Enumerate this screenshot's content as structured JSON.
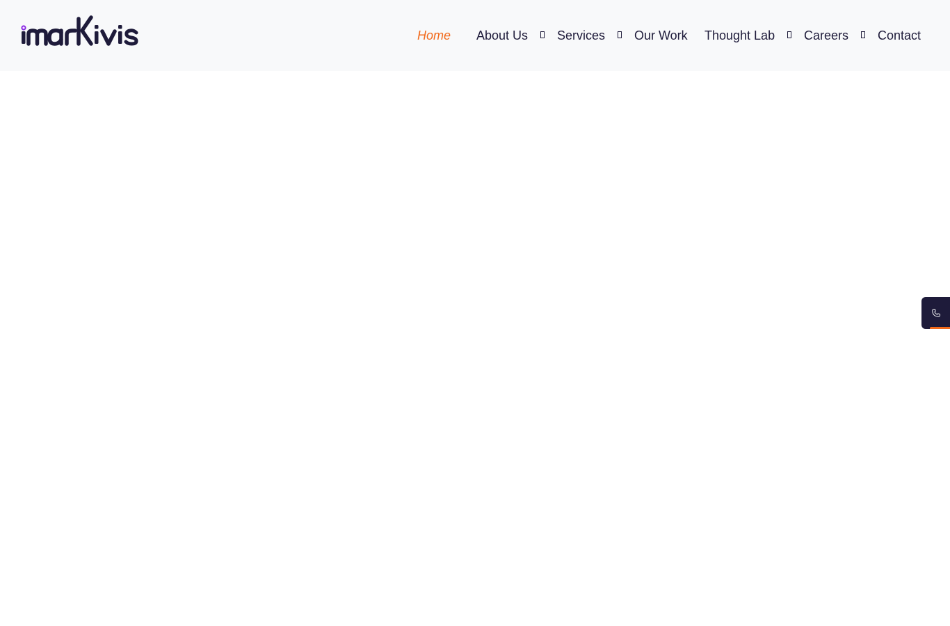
{
  "brand": {
    "logo_text": "markivis",
    "text_color": "#1e1b3a",
    "dot_color": "#8a2be2"
  },
  "nav": {
    "items": [
      {
        "label": "Home",
        "active": true,
        "dropdown": false
      },
      {
        "label": "About Us",
        "active": false,
        "dropdown": true
      },
      {
        "label": "Services",
        "active": false,
        "dropdown": true
      },
      {
        "label": "Our Work",
        "active": false,
        "dropdown": false
      },
      {
        "label": "Thought Lab",
        "active": false,
        "dropdown": true
      },
      {
        "label": "Careers",
        "active": false,
        "dropdown": true
      },
      {
        "label": "Contact",
        "active": false,
        "dropdown": false
      }
    ],
    "active_color": "#f26a1b",
    "text_color": "#1e1b3a"
  },
  "call_widget": {
    "icon": "phone-icon",
    "background": "#1e1b3a",
    "accent": "#f26a1b"
  }
}
